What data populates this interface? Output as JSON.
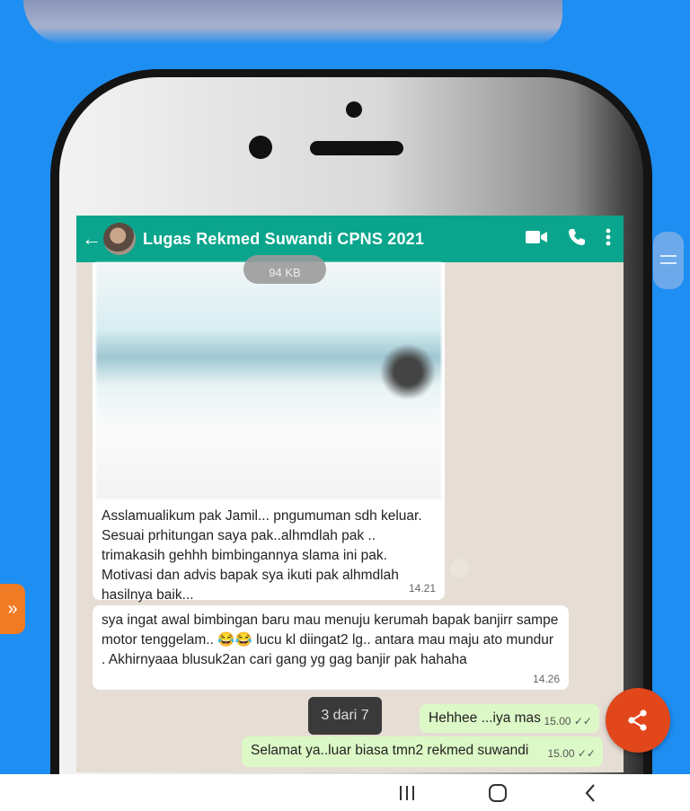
{
  "chat": {
    "contact_name": "Lugas Rekmed Suwandi CPNS 2021",
    "image_size": "94 KB",
    "messages": [
      {
        "text": "Asslamualikum pak Jamil... pngumuman sdh keluar. Sesuai prhitungan saya pak..alhmdlah pak .. trimakasih gehhh bimbingannya slama ini pak. Motivasi dan advis bapak sya ikuti pak alhmdlah hasilnya baik...",
        "time": "14.21"
      },
      {
        "text": "sya ingat awal bimbingan baru mau menuju kerumah bapak banjirr sampe motor tenggelam.. 😂😂 lucu kl diingat2 lg.. antara mau maju ato mundur . Akhirnyaaa blusuk2an cari gang yg gag banjir pak hahaha",
        "time": "14.26"
      }
    ],
    "outgoing": [
      {
        "text": "Hehhee ...iya mas",
        "time": "15.00 ✓✓"
      },
      {
        "text": "Selamat ya..luar biasa tmn2 rekmed suwandi",
        "time": "15.00 ✓✓"
      }
    ]
  },
  "viewer": {
    "pager_label": "3 dari 7"
  },
  "colors": {
    "whatsapp_green": "#0aa58c",
    "outgoing_bubble": "#dcf8c6",
    "background_blue": "#1e8ef2",
    "share_button": "#e2461b",
    "side_tab": "#f07b22"
  },
  "icons": [
    "back-arrow-icon",
    "video-call-icon",
    "phone-icon",
    "more-vert-icon",
    "menu-handle-icon",
    "chevron-right-double-icon",
    "share-icon",
    "recents-icon",
    "home-icon",
    "back-icon"
  ]
}
